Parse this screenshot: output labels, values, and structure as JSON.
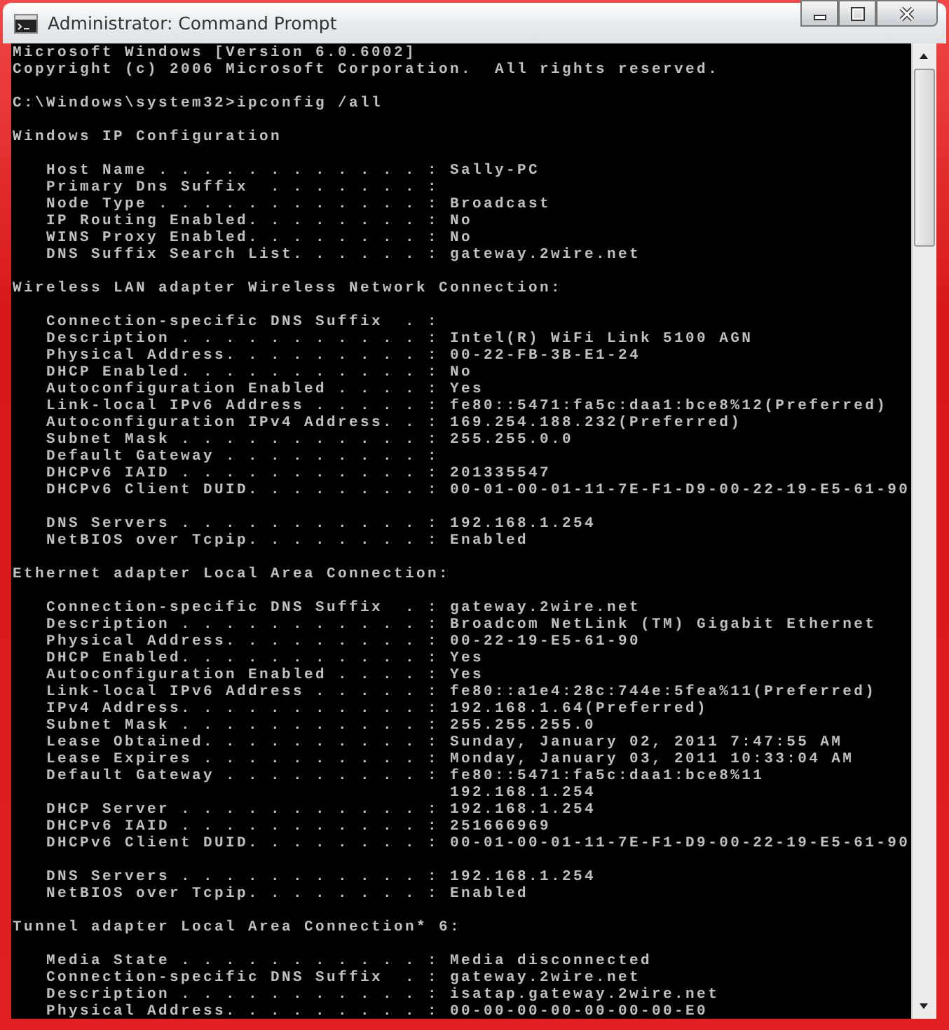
{
  "window": {
    "title": "Administrator: Command Prompt"
  },
  "console": {
    "blocks": [
      {
        "lines": [
          "Microsoft Windows [Version 6.0.6002]",
          "Copyright (c) 2006 Microsoft Corporation.  All rights reserved."
        ]
      },
      {
        "lines": [
          "C:\\Windows\\system32>ipconfig /all"
        ]
      },
      {
        "lines": [
          "Windows IP Configuration"
        ]
      },
      {
        "lines": [
          "   Host Name . . . . . . . . . . . . : Sally-PC",
          "   Primary Dns Suffix  . . . . . . . :",
          "   Node Type . . . . . . . . . . . . : Broadcast",
          "   IP Routing Enabled. . . . . . . . : No",
          "   WINS Proxy Enabled. . . . . . . . : No",
          "   DNS Suffix Search List. . . . . . : gateway.2wire.net"
        ]
      },
      {
        "lines": [
          "Wireless LAN adapter Wireless Network Connection:"
        ]
      },
      {
        "lines": [
          "   Connection-specific DNS Suffix  . :",
          "   Description . . . . . . . . . . . : Intel(R) WiFi Link 5100 AGN",
          "   Physical Address. . . . . . . . . : 00-22-FB-3B-E1-24",
          "   DHCP Enabled. . . . . . . . . . . : No",
          "   Autoconfiguration Enabled . . . . : Yes",
          "   Link-local IPv6 Address . . . . . : fe80::5471:fa5c:daa1:bce8%12(Preferred)",
          "   Autoconfiguration IPv4 Address. . : 169.254.188.232(Preferred)",
          "   Subnet Mask . . . . . . . . . . . : 255.255.0.0",
          "   Default Gateway . . . . . . . . . :",
          "   DHCPv6 IAID . . . . . . . . . . . : 201335547",
          "   DHCPv6 Client DUID. . . . . . . . : 00-01-00-01-11-7E-F1-D9-00-22-19-E5-61-90"
        ]
      },
      {
        "lines": [
          "   DNS Servers . . . . . . . . . . . : 192.168.1.254",
          "   NetBIOS over Tcpip. . . . . . . . : Enabled"
        ]
      },
      {
        "lines": [
          "Ethernet adapter Local Area Connection:"
        ]
      },
      {
        "lines": [
          "   Connection-specific DNS Suffix  . : gateway.2wire.net",
          "   Description . . . . . . . . . . . : Broadcom NetLink (TM) Gigabit Ethernet",
          "   Physical Address. . . . . . . . . : 00-22-19-E5-61-90",
          "   DHCP Enabled. . . . . . . . . . . : Yes",
          "   Autoconfiguration Enabled . . . . : Yes",
          "   Link-local IPv6 Address . . . . . : fe80::a1e4:28c:744e:5fea%11(Preferred)",
          "   IPv4 Address. . . . . . . . . . . : 192.168.1.64(Preferred)",
          "   Subnet Mask . . . . . . . . . . . : 255.255.255.0",
          "   Lease Obtained. . . . . . . . . . : Sunday, January 02, 2011 7:47:55 AM",
          "   Lease Expires . . . . . . . . . . : Monday, January 03, 2011 10:33:04 AM",
          "   Default Gateway . . . . . . . . . : fe80::5471:fa5c:daa1:bce8%11",
          "                                       192.168.1.254",
          "   DHCP Server . . . . . . . . . . . : 192.168.1.254",
          "   DHCPv6 IAID . . . . . . . . . . . : 251666969",
          "   DHCPv6 Client DUID. . . . . . . . : 00-01-00-01-11-7E-F1-D9-00-22-19-E5-61-90"
        ]
      },
      {
        "lines": [
          "   DNS Servers . . . . . . . . . . . : 192.168.1.254",
          "   NetBIOS over Tcpip. . . . . . . . : Enabled"
        ]
      },
      {
        "lines": [
          "Tunnel adapter Local Area Connection* 6:"
        ]
      },
      {
        "lines": [
          "   Media State . . . . . . . . . . . : Media disconnected",
          "   Connection-specific DNS Suffix  . : gateway.2wire.net",
          "   Description . . . . . . . . . . . : isatap.gateway.2wire.net",
          "   Physical Address. . . . . . . . . : 00-00-00-00-00-00-00-E0"
        ]
      }
    ]
  }
}
